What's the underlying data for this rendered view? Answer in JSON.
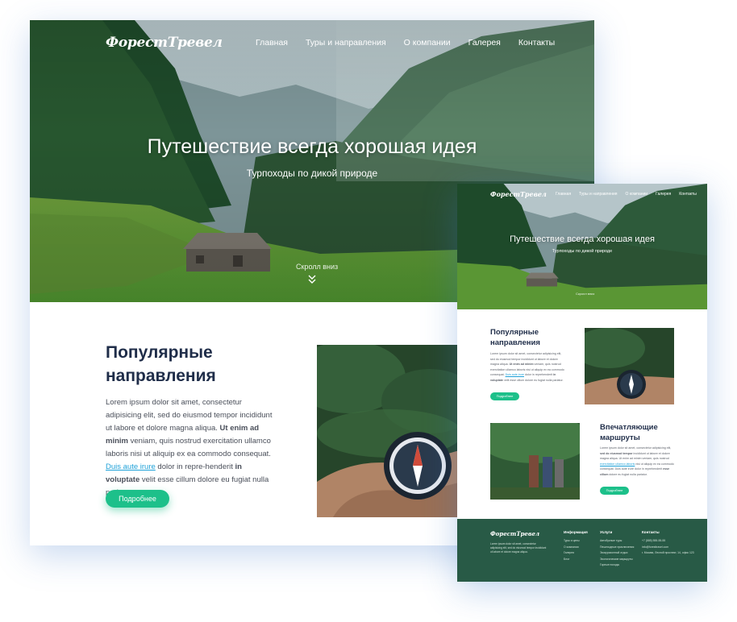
{
  "desktop": {
    "logo": "ФорестТревел",
    "nav": [
      "Главная",
      "Туры и направления",
      "О компании",
      "Галерея",
      "Контакты"
    ],
    "hero": {
      "title": "Путешествие всегда хорошая идея",
      "subtitle": "Турпоходы по дикой природе",
      "scroll": "Скролл вниз"
    },
    "section": {
      "title": "Популярные направления",
      "text_parts": [
        "Lorem ipsum dolor sit amet, consectetur adipisicing elit, sed do eiusmod tempor incididunt ut labore et dolore magna aliqua. ",
        "Ut enim ad minim",
        " veniam, quis nostrud exercitation ullamco laboris nisi ut aliquip ex ea commodo consequat. ",
        "Duis aute irure",
        " dolor in repre-henderit ",
        "in voluptate",
        " velit esse cillum dolore eu fugiat nulla pariatur."
      ],
      "button": "Подробнее"
    }
  },
  "mobile": {
    "logo": "ФорестТревел",
    "nav": [
      "Главная",
      "Туры и направления",
      "О компании",
      "Галерея",
      "Контакты"
    ],
    "hero": {
      "title": "Путешествие всегда хорошая идея",
      "subtitle": "Турпоходы по дикой природе",
      "scroll": "Скролл вниз"
    },
    "section1": {
      "title": "Популярные направления",
      "text_parts": [
        "Lorem ipsum dolor sit amet, consectetur adipisicing elit, sed do eiusmod tempor incididunt ut labore et dolore magna aliqua. ",
        "Ut enim ad minim",
        " veniam, quis nostrud exercitation ullamco laboris nisi ut aliquip ex ea commodo consequat. ",
        "Duis aute irure",
        " dolor in reprehenderit ",
        "in voluptate",
        " velit esse cillum dolore eu fugiat nulla pariatur."
      ],
      "button": "Подробнее"
    },
    "section2": {
      "title": "Впечатляющие маршруты",
      "text_parts": [
        "Lorem ipsum dolor sit amet, consectetur adipisicing elit, ",
        "sed do eiusmod tempor",
        " incididunt ut labore et dolore magna aliqua. Ut enim ad minim veniam, quis nostrud ",
        "exercitation ullamco laboris",
        " nisi ut aliquip ex ea commodo consequat. Duis aute irure dolor in reprehenderit ",
        "esse cillum",
        " dolore eu fugiat nulla pariatur."
      ],
      "button": "Подробнее"
    },
    "footer": {
      "logo": "ФорестТревел",
      "about": "Lorem ipsum dolor sit amet, consectetur adipisicing elit, sed do eiusmod tempor incididunt ut labore et dolore magna aliqua.",
      "columns": [
        {
          "title": "Информация",
          "items": [
            "Туры и цены",
            "О компании",
            "Галерея",
            "Блог"
          ]
        },
        {
          "title": "Услуги",
          "items": [
            "Автобусные туры",
            "Пешеходные приключения",
            "Экскурсионный отдых",
            "Экологические маршруты",
            "Горные походы"
          ]
        },
        {
          "title": "Контакты",
          "items": [
            "+7 (885) 555-55-55",
            "info@foresttravel.com",
            "г. Москва, Лесной проспект, 14, офис 123"
          ]
        }
      ]
    }
  },
  "colors": {
    "accent": "#1dc08a",
    "heading": "#1f2d49",
    "link": "#1ea1d8",
    "footer": "#285a46"
  }
}
